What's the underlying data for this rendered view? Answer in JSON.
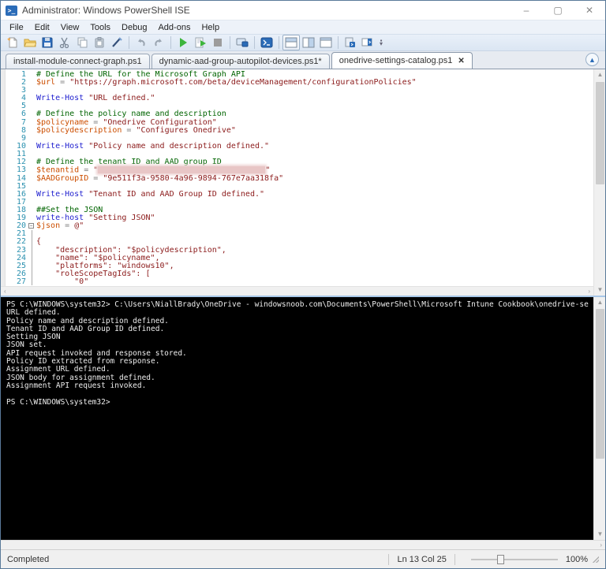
{
  "window": {
    "title": "Administrator: Windows PowerShell ISE",
    "controls": {
      "minimize": "–",
      "maximize": "▢",
      "close": "✕"
    }
  },
  "menu": {
    "items": [
      "File",
      "Edit",
      "View",
      "Tools",
      "Debug",
      "Add-ons",
      "Help"
    ]
  },
  "toolbar": {
    "groups": [
      [
        "new-script-icon",
        "open-script-icon",
        "save-icon",
        "cut-icon",
        "copy-icon",
        "paste-icon",
        "clear-console-pane-icon"
      ],
      [
        "undo-icon",
        "redo-icon"
      ],
      [
        "run-script-icon",
        "run-selection-icon",
        "stop-operation-icon"
      ],
      [
        "new-remote-powershell-tab-icon"
      ],
      [
        "start-powershell-icon"
      ],
      [
        "show-script-pane-top-icon",
        "show-script-pane-right-icon",
        "show-script-pane-maximized-icon"
      ],
      [
        "new-powershell-tab-icon",
        "show-script-pane-right-badge-icon"
      ]
    ],
    "selected": "show-script-pane-top-icon"
  },
  "tabs": [
    {
      "label": "install-module-connect-graph.ps1",
      "active": false
    },
    {
      "label": "dynamic-aad-group-autopilot-devices.ps1*",
      "active": false
    },
    {
      "label": "onedrive-settings-catalog.ps1",
      "active": true,
      "close": "✕"
    }
  ],
  "editor": {
    "lines": [
      {
        "n": 1,
        "seg": [
          [
            "c",
            "# Define the URL for the Microsoft Graph API"
          ]
        ]
      },
      {
        "n": 2,
        "seg": [
          [
            "v",
            "$url"
          ],
          [
            "p",
            " "
          ],
          [
            "o",
            "="
          ],
          [
            "p",
            " "
          ],
          [
            "s",
            "\"https://graph.microsoft.com/beta/deviceManagement/configurationPolicies\""
          ]
        ]
      },
      {
        "n": 3,
        "seg": []
      },
      {
        "n": 4,
        "seg": [
          [
            "k",
            "Write-Host"
          ],
          [
            "p",
            " "
          ],
          [
            "s",
            "\"URL defined.\""
          ]
        ]
      },
      {
        "n": 5,
        "seg": []
      },
      {
        "n": 6,
        "seg": [
          [
            "c",
            "# Define the policy name and description"
          ]
        ]
      },
      {
        "n": 7,
        "seg": [
          [
            "v",
            "$policyname"
          ],
          [
            "p",
            " "
          ],
          [
            "o",
            "="
          ],
          [
            "p",
            " "
          ],
          [
            "s",
            "\"Onedrive Configuration\""
          ]
        ]
      },
      {
        "n": 8,
        "seg": [
          [
            "v",
            "$policydescription"
          ],
          [
            "p",
            " "
          ],
          [
            "o",
            "="
          ],
          [
            "p",
            " "
          ],
          [
            "s",
            "\"Configures Onedrive\""
          ]
        ]
      },
      {
        "n": 9,
        "seg": []
      },
      {
        "n": 10,
        "seg": [
          [
            "k",
            "Write-Host"
          ],
          [
            "p",
            " "
          ],
          [
            "s",
            "\"Policy name and description defined.\""
          ]
        ]
      },
      {
        "n": 11,
        "seg": []
      },
      {
        "n": 12,
        "seg": [
          [
            "c",
            "# Define the tenant ID and AAD group ID"
          ]
        ]
      },
      {
        "n": 13,
        "seg": [
          [
            "v",
            "$tenantid"
          ],
          [
            "p",
            " "
          ],
          [
            "o",
            "="
          ],
          [
            "p",
            " "
          ],
          [
            "s",
            "\""
          ],
          [
            "r",
            ""
          ],
          [
            "s",
            "\""
          ]
        ]
      },
      {
        "n": 14,
        "seg": [
          [
            "v",
            "$AADGroupID"
          ],
          [
            "p",
            " "
          ],
          [
            "o",
            "="
          ],
          [
            "p",
            " "
          ],
          [
            "s",
            "\"9e511f3a-9580-4a96-9894-767e7aa318fa\""
          ]
        ]
      },
      {
        "n": 15,
        "seg": []
      },
      {
        "n": 16,
        "seg": [
          [
            "k",
            "Write-Host"
          ],
          [
            "p",
            " "
          ],
          [
            "s",
            "\"Tenant ID and AAD Group ID defined.\""
          ]
        ]
      },
      {
        "n": 17,
        "seg": []
      },
      {
        "n": 18,
        "seg": [
          [
            "c",
            "##Set the JSON"
          ]
        ]
      },
      {
        "n": 19,
        "seg": [
          [
            "k",
            "write-host"
          ],
          [
            "p",
            " "
          ],
          [
            "s",
            "\"Setting JSON\""
          ]
        ]
      },
      {
        "n": 20,
        "fold": true,
        "seg": [
          [
            "v",
            "$json"
          ],
          [
            "p",
            " "
          ],
          [
            "o",
            "="
          ],
          [
            "p",
            " "
          ],
          [
            "s",
            "@\""
          ]
        ]
      },
      {
        "n": 21,
        "seg": []
      },
      {
        "n": 22,
        "seg": [
          [
            "s",
            "{"
          ]
        ]
      },
      {
        "n": 23,
        "seg": [
          [
            "s",
            "    \"description\": \"$policydescription\","
          ]
        ]
      },
      {
        "n": 24,
        "seg": [
          [
            "s",
            "    \"name\": \"$policyname\","
          ]
        ]
      },
      {
        "n": 25,
        "seg": [
          [
            "s",
            "    \"platforms\": \"windows10\","
          ]
        ]
      },
      {
        "n": 26,
        "seg": [
          [
            "s",
            "    \"roleScopeTagIds\": ["
          ]
        ]
      },
      {
        "n": 27,
        "seg": [
          [
            "s",
            "        \"0\""
          ]
        ]
      }
    ]
  },
  "console": {
    "lines": [
      "PS C:\\WINDOWS\\system32> C:\\Users\\NiallBrady\\OneDrive - windowsnoob.com\\Documents\\PowerShell\\Microsoft Intune Cookbook\\onedrive-se",
      "URL defined.",
      "Policy name and description defined.",
      "Tenant ID and AAD Group ID defined.",
      "Setting JSON",
      "JSON set.",
      "API request invoked and response stored.",
      "Policy ID extracted from response.",
      "Assignment URL defined.",
      "JSON body for assignment defined.",
      "Assignment API request invoked.",
      "",
      "PS C:\\WINDOWS\\system32> "
    ]
  },
  "statusbar": {
    "status": "Completed",
    "position": "Ln 13 Col 25",
    "zoom_percent": "100%"
  },
  "colors": {
    "comment": "#006400",
    "variable": "#cc4e00",
    "cmdlet": "#1f1fcf",
    "string": "#8b1a1a",
    "line_number": "#2b91af",
    "console_bg": "#000000",
    "run_green": "#3db53d",
    "powershell_blue": "#2b6cb8",
    "splitter_blue": "#a8c7e8"
  }
}
